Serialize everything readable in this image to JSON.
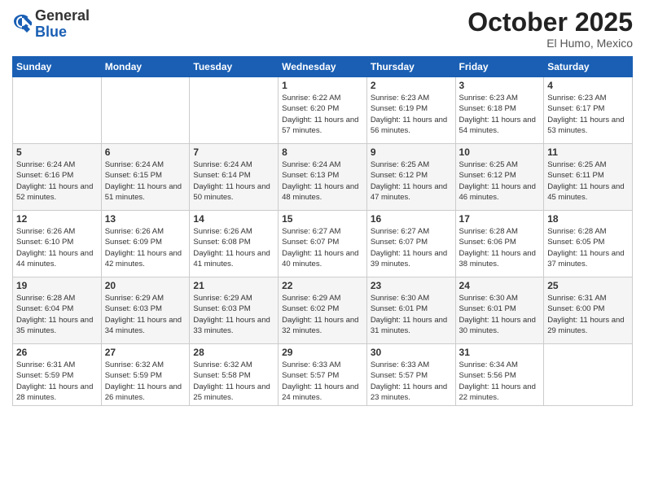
{
  "header": {
    "logo_general": "General",
    "logo_blue": "Blue",
    "month": "October 2025",
    "location": "El Humo, Mexico"
  },
  "days_of_week": [
    "Sunday",
    "Monday",
    "Tuesday",
    "Wednesday",
    "Thursday",
    "Friday",
    "Saturday"
  ],
  "weeks": [
    [
      {
        "num": "",
        "info": ""
      },
      {
        "num": "",
        "info": ""
      },
      {
        "num": "",
        "info": ""
      },
      {
        "num": "1",
        "info": "Sunrise: 6:22 AM\nSunset: 6:20 PM\nDaylight: 11 hours and 57 minutes."
      },
      {
        "num": "2",
        "info": "Sunrise: 6:23 AM\nSunset: 6:19 PM\nDaylight: 11 hours and 56 minutes."
      },
      {
        "num": "3",
        "info": "Sunrise: 6:23 AM\nSunset: 6:18 PM\nDaylight: 11 hours and 54 minutes."
      },
      {
        "num": "4",
        "info": "Sunrise: 6:23 AM\nSunset: 6:17 PM\nDaylight: 11 hours and 53 minutes."
      }
    ],
    [
      {
        "num": "5",
        "info": "Sunrise: 6:24 AM\nSunset: 6:16 PM\nDaylight: 11 hours and 52 minutes."
      },
      {
        "num": "6",
        "info": "Sunrise: 6:24 AM\nSunset: 6:15 PM\nDaylight: 11 hours and 51 minutes."
      },
      {
        "num": "7",
        "info": "Sunrise: 6:24 AM\nSunset: 6:14 PM\nDaylight: 11 hours and 50 minutes."
      },
      {
        "num": "8",
        "info": "Sunrise: 6:24 AM\nSunset: 6:13 PM\nDaylight: 11 hours and 48 minutes."
      },
      {
        "num": "9",
        "info": "Sunrise: 6:25 AM\nSunset: 6:12 PM\nDaylight: 11 hours and 47 minutes."
      },
      {
        "num": "10",
        "info": "Sunrise: 6:25 AM\nSunset: 6:12 PM\nDaylight: 11 hours and 46 minutes."
      },
      {
        "num": "11",
        "info": "Sunrise: 6:25 AM\nSunset: 6:11 PM\nDaylight: 11 hours and 45 minutes."
      }
    ],
    [
      {
        "num": "12",
        "info": "Sunrise: 6:26 AM\nSunset: 6:10 PM\nDaylight: 11 hours and 44 minutes."
      },
      {
        "num": "13",
        "info": "Sunrise: 6:26 AM\nSunset: 6:09 PM\nDaylight: 11 hours and 42 minutes."
      },
      {
        "num": "14",
        "info": "Sunrise: 6:26 AM\nSunset: 6:08 PM\nDaylight: 11 hours and 41 minutes."
      },
      {
        "num": "15",
        "info": "Sunrise: 6:27 AM\nSunset: 6:07 PM\nDaylight: 11 hours and 40 minutes."
      },
      {
        "num": "16",
        "info": "Sunrise: 6:27 AM\nSunset: 6:07 PM\nDaylight: 11 hours and 39 minutes."
      },
      {
        "num": "17",
        "info": "Sunrise: 6:28 AM\nSunset: 6:06 PM\nDaylight: 11 hours and 38 minutes."
      },
      {
        "num": "18",
        "info": "Sunrise: 6:28 AM\nSunset: 6:05 PM\nDaylight: 11 hours and 37 minutes."
      }
    ],
    [
      {
        "num": "19",
        "info": "Sunrise: 6:28 AM\nSunset: 6:04 PM\nDaylight: 11 hours and 35 minutes."
      },
      {
        "num": "20",
        "info": "Sunrise: 6:29 AM\nSunset: 6:03 PM\nDaylight: 11 hours and 34 minutes."
      },
      {
        "num": "21",
        "info": "Sunrise: 6:29 AM\nSunset: 6:03 PM\nDaylight: 11 hours and 33 minutes."
      },
      {
        "num": "22",
        "info": "Sunrise: 6:29 AM\nSunset: 6:02 PM\nDaylight: 11 hours and 32 minutes."
      },
      {
        "num": "23",
        "info": "Sunrise: 6:30 AM\nSunset: 6:01 PM\nDaylight: 11 hours and 31 minutes."
      },
      {
        "num": "24",
        "info": "Sunrise: 6:30 AM\nSunset: 6:01 PM\nDaylight: 11 hours and 30 minutes."
      },
      {
        "num": "25",
        "info": "Sunrise: 6:31 AM\nSunset: 6:00 PM\nDaylight: 11 hours and 29 minutes."
      }
    ],
    [
      {
        "num": "26",
        "info": "Sunrise: 6:31 AM\nSunset: 5:59 PM\nDaylight: 11 hours and 28 minutes."
      },
      {
        "num": "27",
        "info": "Sunrise: 6:32 AM\nSunset: 5:59 PM\nDaylight: 11 hours and 26 minutes."
      },
      {
        "num": "28",
        "info": "Sunrise: 6:32 AM\nSunset: 5:58 PM\nDaylight: 11 hours and 25 minutes."
      },
      {
        "num": "29",
        "info": "Sunrise: 6:33 AM\nSunset: 5:57 PM\nDaylight: 11 hours and 24 minutes."
      },
      {
        "num": "30",
        "info": "Sunrise: 6:33 AM\nSunset: 5:57 PM\nDaylight: 11 hours and 23 minutes."
      },
      {
        "num": "31",
        "info": "Sunrise: 6:34 AM\nSunset: 5:56 PM\nDaylight: 11 hours and 22 minutes."
      },
      {
        "num": "",
        "info": ""
      }
    ]
  ]
}
